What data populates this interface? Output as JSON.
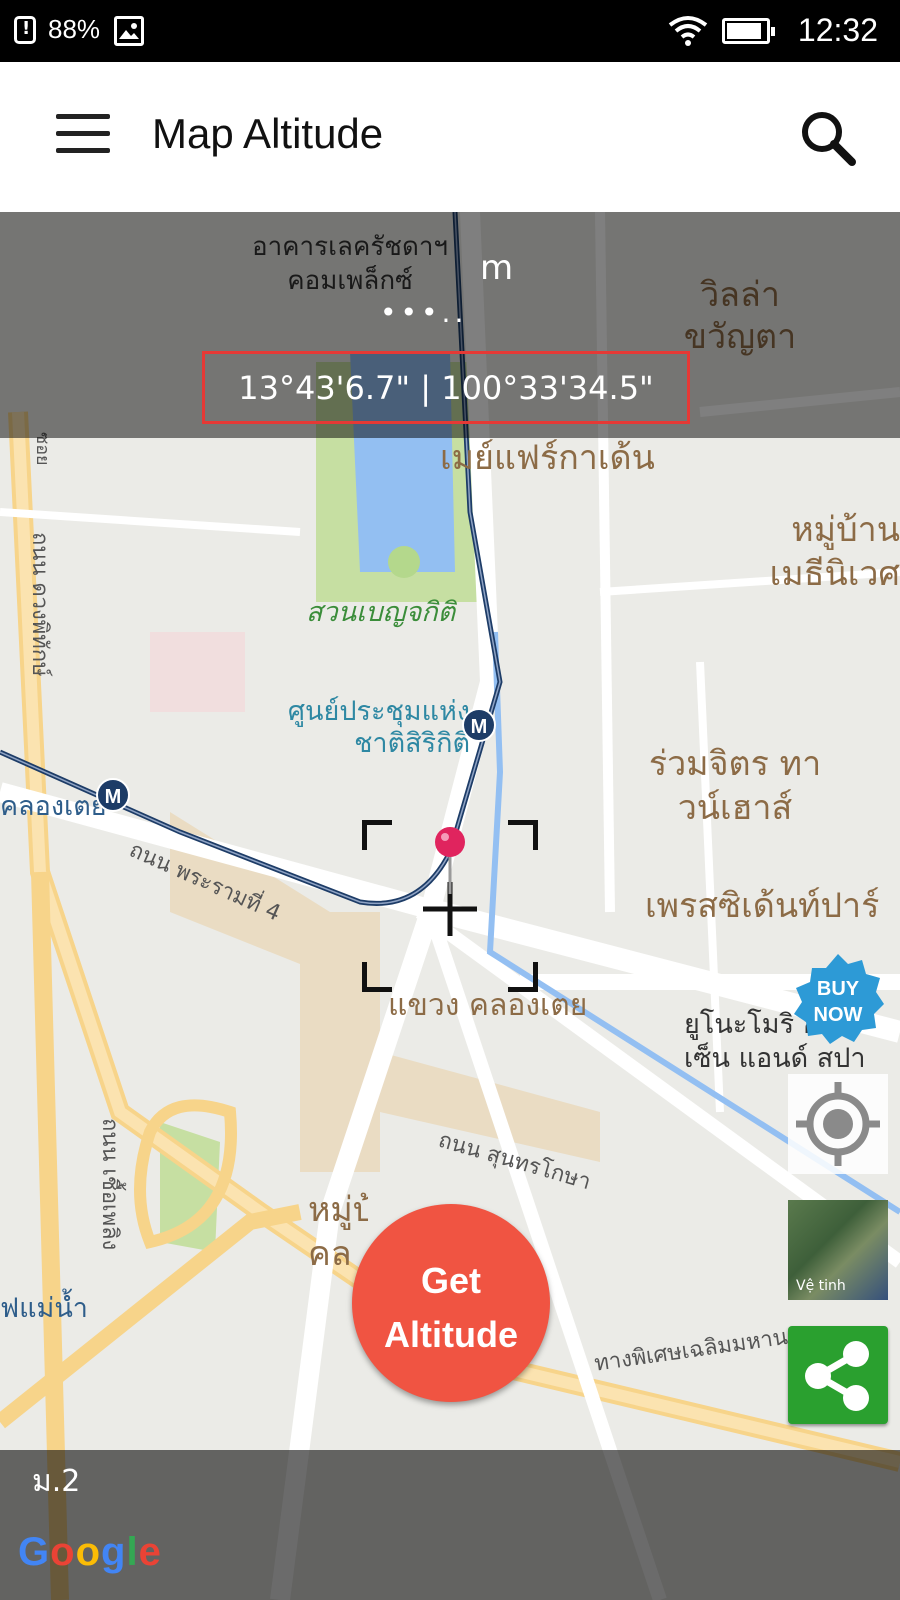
{
  "status_bar": {
    "battery_percent": "88%",
    "time": "12:32"
  },
  "app_bar": {
    "title": "Map Altitude"
  },
  "overlay": {
    "altitude_value": "m",
    "loading_indicator": "•••..",
    "coordinates": "13°43'6.7\" | 100°33'34.5\""
  },
  "map": {
    "labels": {
      "building_complex": "อาคารเลครัชดาฯ คอมเพล็กซ์",
      "villa": "วิลล่า ขวัญตา",
      "may_fair": "เมย์แฟร์กาเด้น",
      "village_north_east": "หมู่บ้าน เมธีนิเวศ",
      "benjakitti_park": "สวนเบญจกิติ",
      "convention_center": "ศูนย์ประชุมแห่ง ชาติสิริกิติ์",
      "ruam_jit": "ร่วมจิตร ทาวน์เฮาส์",
      "president": "เพรสซิเด้นท์ปาร์",
      "khlong_toei_station": "คลองเตย",
      "rama4_road": "ถนน พระรามที่ 4",
      "khlong_toei_district": "แขวง คลองเตย",
      "yunomori": "ยูโนะโมริ ออนเซ็น แอนด์ สปา",
      "sunthorn_kosa_road": "ถนน สุนทรโกษา",
      "village_bottom": "หมู่บ้าน คล",
      "duang_phithak_road": "ถนน ดวงพิทักษ์",
      "chuea_phloeng_road": "ถนน เชื้อเพลิง",
      "mae_nam_station": "ฟแม่น้ำ",
      "expressway": "ทางพิเศษเฉลิมมหานคร",
      "soi": "ซอย"
    }
  },
  "bottom_bar": {
    "label": "ม.2",
    "google_logo": [
      "G",
      "o",
      "o",
      "g",
      "l",
      "e"
    ]
  },
  "controls": {
    "buy_now": "BUY NOW",
    "satellite_label": "Vệ tinh",
    "get_altitude": "Get Altitude"
  },
  "colors": {
    "fab": "#f05442",
    "coord_border": "#e53935",
    "share": "#2aa02f",
    "google": [
      "#4285F4",
      "#EA4335",
      "#FBBC05",
      "#4285F4",
      "#34A853",
      "#EA4335"
    ]
  }
}
